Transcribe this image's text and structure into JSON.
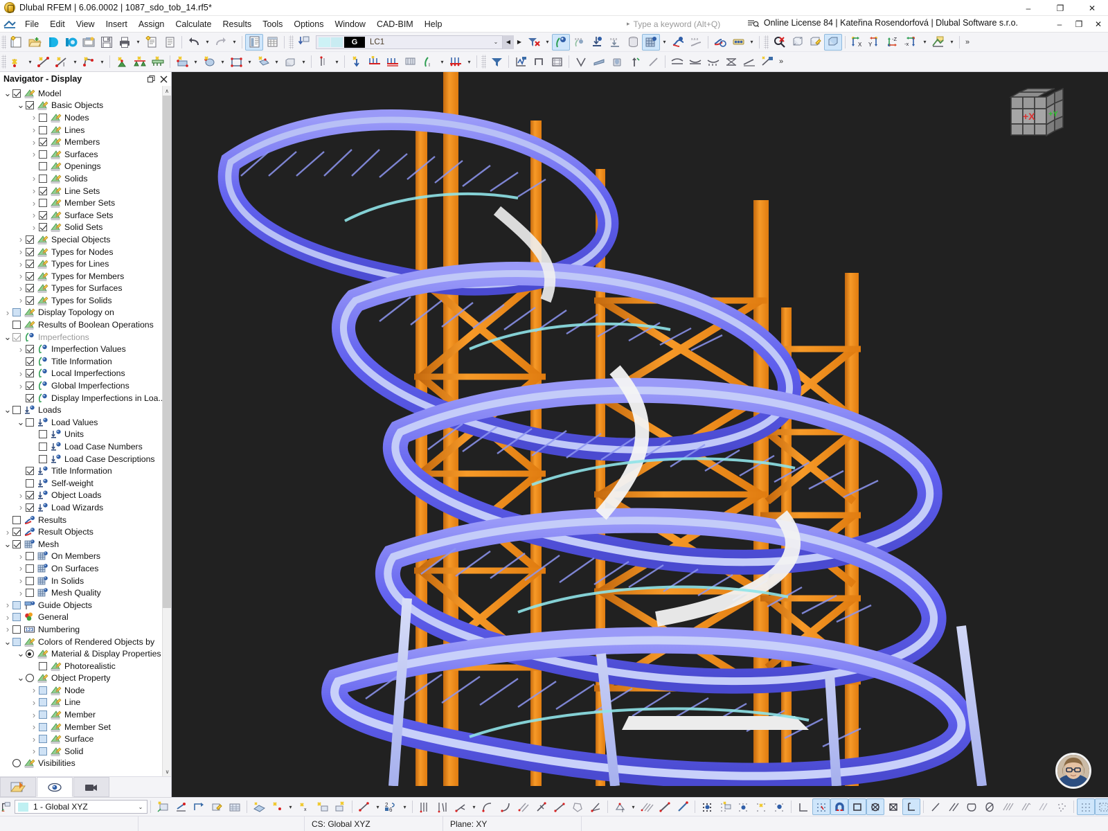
{
  "window": {
    "title": "Dlubal RFEM | 6.06.0002 | 1087_sdo_tob_14.rf5*",
    "app_icon": "rfem-logo-icon",
    "minimize": "–",
    "restore": "❐",
    "close": "✕"
  },
  "menubar": {
    "items": [
      {
        "label": "File"
      },
      {
        "label": "Edit"
      },
      {
        "label": "View"
      },
      {
        "label": "Insert"
      },
      {
        "label": "Assign"
      },
      {
        "label": "Calculate"
      },
      {
        "label": "Results"
      },
      {
        "label": "Tools"
      },
      {
        "label": "Options"
      },
      {
        "label": "Window"
      },
      {
        "label": "CAD-BIM"
      },
      {
        "label": "Help"
      }
    ],
    "search_placeholder": "Type a keyword (Alt+Q)",
    "search_arrow": "▸",
    "license": "Online License 84 | Kateřina Rosendorfová | Dlubal Software s.r.o.",
    "license_icon": "search-list-icon",
    "minimize": "–",
    "restore": "❐",
    "close": "✕"
  },
  "toolbar": {
    "load_case": {
      "group_label": "G",
      "value": "LC1",
      "dropdown_caret": "⌄",
      "prev": "◀",
      "next": "▶"
    },
    "overflow": "»",
    "caret": "▾"
  },
  "navigator": {
    "title": "Navigator - Display",
    "undock_icon": "undock-icon",
    "close_icon": "close-icon",
    "tabs": [
      {
        "name": "tab-project-navigator",
        "icon": "project-folder-icon",
        "selected": false
      },
      {
        "name": "tab-display-navigator",
        "icon": "eye-icon",
        "selected": true
      },
      {
        "name": "tab-views-navigator",
        "icon": "camera-icon",
        "selected": false
      }
    ],
    "tree": [
      {
        "label": "Model",
        "indent": 0,
        "twisty": "expanded",
        "control": "check-on",
        "icon": "model-icon"
      },
      {
        "label": "Basic Objects",
        "indent": 1,
        "twisty": "expanded",
        "control": "check-on",
        "icon": "model-icon"
      },
      {
        "label": "Nodes",
        "indent": 2,
        "twisty": "collapsed",
        "control": "check-off",
        "icon": "model-icon"
      },
      {
        "label": "Lines",
        "indent": 2,
        "twisty": "collapsed",
        "control": "check-off",
        "icon": "model-icon"
      },
      {
        "label": "Members",
        "indent": 2,
        "twisty": "collapsed",
        "control": "check-on",
        "icon": "model-icon"
      },
      {
        "label": "Surfaces",
        "indent": 2,
        "twisty": "collapsed",
        "control": "check-off",
        "icon": "model-icon"
      },
      {
        "label": "Openings",
        "indent": 2,
        "twisty": "none",
        "control": "check-off",
        "icon": "model-icon"
      },
      {
        "label": "Solids",
        "indent": 2,
        "twisty": "collapsed",
        "control": "check-off",
        "icon": "model-icon"
      },
      {
        "label": "Line Sets",
        "indent": 2,
        "twisty": "collapsed",
        "control": "check-on",
        "icon": "model-icon"
      },
      {
        "label": "Member Sets",
        "indent": 2,
        "twisty": "collapsed",
        "control": "check-off",
        "icon": "model-icon"
      },
      {
        "label": "Surface Sets",
        "indent": 2,
        "twisty": "collapsed",
        "control": "check-on",
        "icon": "model-icon"
      },
      {
        "label": "Solid Sets",
        "indent": 2,
        "twisty": "collapsed",
        "control": "check-on",
        "icon": "model-icon"
      },
      {
        "label": "Special Objects",
        "indent": 1,
        "twisty": "collapsed",
        "control": "check-on",
        "icon": "model-icon"
      },
      {
        "label": "Types for Nodes",
        "indent": 1,
        "twisty": "collapsed",
        "control": "check-on",
        "icon": "model-icon"
      },
      {
        "label": "Types for Lines",
        "indent": 1,
        "twisty": "collapsed",
        "control": "check-on",
        "icon": "model-icon"
      },
      {
        "label": "Types for Members",
        "indent": 1,
        "twisty": "collapsed",
        "control": "check-on",
        "icon": "model-icon"
      },
      {
        "label": "Types for Surfaces",
        "indent": 1,
        "twisty": "collapsed",
        "control": "check-on",
        "icon": "model-icon"
      },
      {
        "label": "Types for Solids",
        "indent": 1,
        "twisty": "collapsed",
        "control": "check-on",
        "icon": "model-icon"
      },
      {
        "label": "Display Topology on",
        "indent": 0,
        "twisty": "collapsed",
        "control": "check-blue",
        "icon": "model-icon"
      },
      {
        "label": "Results of Boolean Operations",
        "indent": 0,
        "twisty": "none",
        "control": "check-off",
        "icon": "model-icon"
      },
      {
        "label": "Imperfections",
        "indent": 0,
        "twisty": "expanded",
        "control": "check-gray",
        "icon": "imperfection-icon",
        "dim": true
      },
      {
        "label": "Imperfection Values",
        "indent": 1,
        "twisty": "collapsed",
        "control": "check-on",
        "icon": "imperfection-icon"
      },
      {
        "label": "Title Information",
        "indent": 1,
        "twisty": "none",
        "control": "check-on",
        "icon": "imperfection-icon"
      },
      {
        "label": "Local Imperfections",
        "indent": 1,
        "twisty": "collapsed",
        "control": "check-on",
        "icon": "imperfection-icon"
      },
      {
        "label": "Global Imperfections",
        "indent": 1,
        "twisty": "collapsed",
        "control": "check-on",
        "icon": "imperfection-icon"
      },
      {
        "label": "Display Imperfections in Loa...",
        "indent": 1,
        "twisty": "none",
        "control": "check-on",
        "icon": "imperfection-icon"
      },
      {
        "label": "Loads",
        "indent": 0,
        "twisty": "expanded",
        "control": "check-off",
        "icon": "load-icon"
      },
      {
        "label": "Load Values",
        "indent": 1,
        "twisty": "expanded",
        "control": "check-off",
        "icon": "load-icon"
      },
      {
        "label": "Units",
        "indent": 2,
        "twisty": "none",
        "control": "check-off",
        "icon": "load-icon"
      },
      {
        "label": "Load Case Numbers",
        "indent": 2,
        "twisty": "none",
        "control": "check-off",
        "icon": "load-icon"
      },
      {
        "label": "Load Case Descriptions",
        "indent": 2,
        "twisty": "none",
        "control": "check-off",
        "icon": "load-icon"
      },
      {
        "label": "Title Information",
        "indent": 1,
        "twisty": "none",
        "control": "check-on",
        "icon": "load-icon"
      },
      {
        "label": "Self-weight",
        "indent": 1,
        "twisty": "none",
        "control": "check-off",
        "icon": "load-icon"
      },
      {
        "label": "Object Loads",
        "indent": 1,
        "twisty": "collapsed",
        "control": "check-on",
        "icon": "load-icon"
      },
      {
        "label": "Load Wizards",
        "indent": 1,
        "twisty": "collapsed",
        "control": "check-on",
        "icon": "load-icon"
      },
      {
        "label": "Results",
        "indent": 0,
        "twisty": "none",
        "control": "check-off",
        "icon": "results-icon"
      },
      {
        "label": "Result Objects",
        "indent": 0,
        "twisty": "collapsed",
        "control": "check-on",
        "icon": "results-icon"
      },
      {
        "label": "Mesh",
        "indent": 0,
        "twisty": "expanded",
        "control": "check-on",
        "icon": "mesh-icon"
      },
      {
        "label": "On Members",
        "indent": 1,
        "twisty": "collapsed",
        "control": "check-off",
        "icon": "mesh-icon"
      },
      {
        "label": "On Surfaces",
        "indent": 1,
        "twisty": "collapsed",
        "control": "check-off",
        "icon": "mesh-icon"
      },
      {
        "label": "In Solids",
        "indent": 1,
        "twisty": "collapsed",
        "control": "check-off",
        "icon": "mesh-icon"
      },
      {
        "label": "Mesh Quality",
        "indent": 1,
        "twisty": "collapsed",
        "control": "check-off",
        "icon": "mesh-icon"
      },
      {
        "label": "Guide Objects",
        "indent": 0,
        "twisty": "collapsed",
        "control": "check-blue",
        "icon": "guide-icon"
      },
      {
        "label": "General",
        "indent": 0,
        "twisty": "collapsed",
        "control": "check-blue",
        "icon": "general-icon"
      },
      {
        "label": "Numbering",
        "indent": 0,
        "twisty": "collapsed",
        "control": "check-off",
        "icon": "numbering-icon"
      },
      {
        "label": "Colors of Rendered Objects by",
        "indent": 0,
        "twisty": "expanded",
        "control": "check-blue",
        "icon": "model-icon"
      },
      {
        "label": "Material & Display Properties",
        "indent": 1,
        "twisty": "expanded",
        "control": "radio-on",
        "icon": "model-icon"
      },
      {
        "label": "Photorealistic",
        "indent": 2,
        "twisty": "none",
        "control": "check-off",
        "icon": "model-icon"
      },
      {
        "label": "Object Property",
        "indent": 1,
        "twisty": "expanded",
        "control": "radio-off",
        "icon": "model-icon"
      },
      {
        "label": "Node",
        "indent": 2,
        "twisty": "collapsed",
        "control": "check-blue",
        "icon": "model-icon"
      },
      {
        "label": "Line",
        "indent": 2,
        "twisty": "collapsed",
        "control": "check-blue",
        "icon": "model-icon"
      },
      {
        "label": "Member",
        "indent": 2,
        "twisty": "collapsed",
        "control": "check-blue",
        "icon": "model-icon"
      },
      {
        "label": "Member Set",
        "indent": 2,
        "twisty": "collapsed",
        "control": "check-blue",
        "icon": "model-icon"
      },
      {
        "label": "Surface",
        "indent": 2,
        "twisty": "collapsed",
        "control": "check-blue",
        "icon": "model-icon"
      },
      {
        "label": "Solid",
        "indent": 2,
        "twisty": "collapsed",
        "control": "check-blue",
        "icon": "model-icon"
      },
      {
        "label": "Visibilities",
        "indent": 0,
        "twisty": "none",
        "control": "radio-off",
        "icon": "model-icon"
      }
    ],
    "scroll_up": "∧",
    "scroll_down": "∨"
  },
  "viewport": {
    "background": "#212121",
    "viewcube": {
      "x_label": "+X",
      "x_color": "#d93232",
      "y_label": "+Y",
      "y_color": "#2fc22f"
    },
    "model": {
      "orange": "#f08a1e",
      "blue": "#6a6af0",
      "light_blue": "#a8b4f2",
      "white": "#f2f2f2",
      "cyan": "#8fe3e8"
    },
    "avatar_name": "user-avatar"
  },
  "bottom": {
    "cs_combo": {
      "value": "1 - Global XYZ",
      "caret": "⌄",
      "swatch": "#bff0f2"
    }
  },
  "statusbar": {
    "cs": "CS: Global XYZ",
    "plane": "Plane: XY"
  }
}
